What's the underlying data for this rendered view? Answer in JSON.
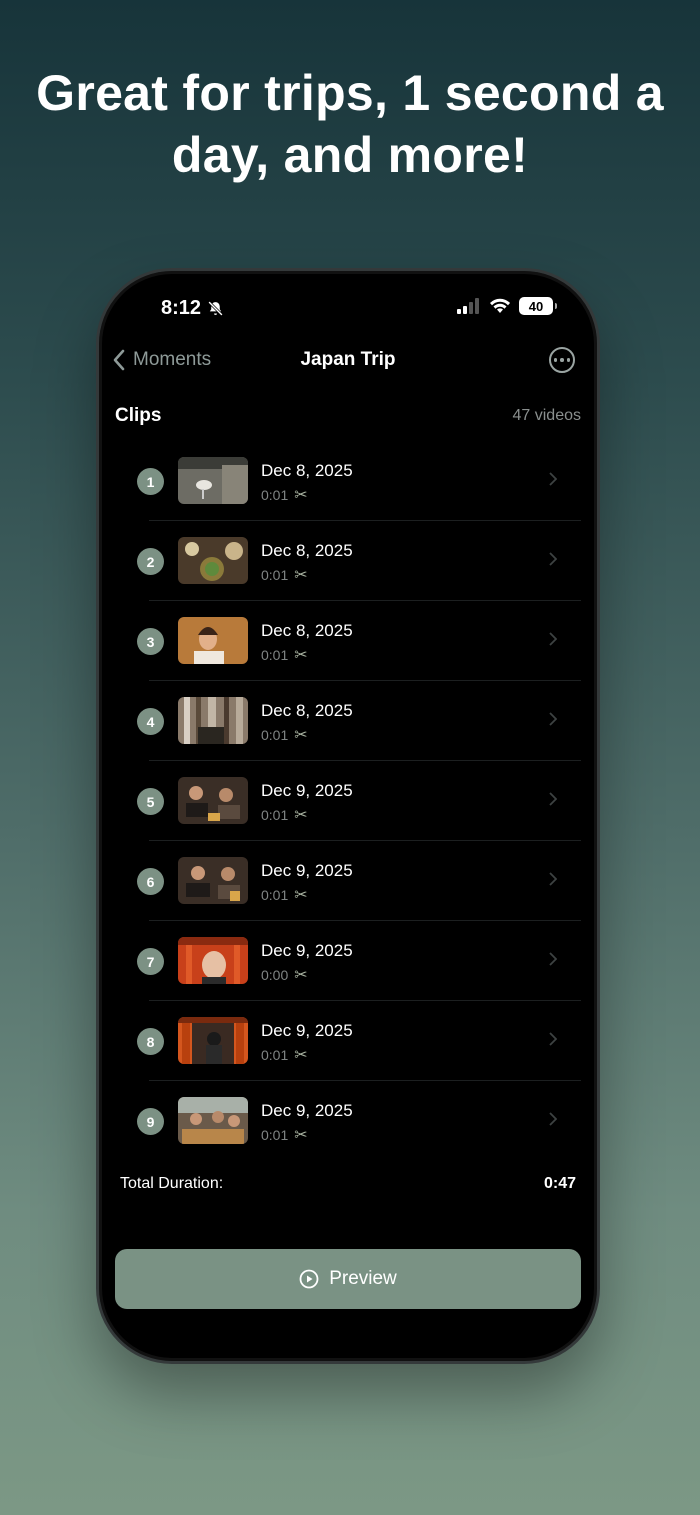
{
  "headline": "Great for trips, 1 second a day, and more!",
  "status_bar": {
    "time": "8:12",
    "battery": "40",
    "icons": [
      "bell-slash-icon",
      "signal-icon",
      "wifi-icon",
      "battery-icon"
    ]
  },
  "nav": {
    "back_label": "Moments",
    "title": "Japan Trip",
    "more_icon": "ellipsis-circle-icon"
  },
  "clips_section": {
    "label": "Clips",
    "count": "47 videos"
  },
  "clips": [
    {
      "number": "1",
      "date": "Dec 8, 2025",
      "duration": "0:01"
    },
    {
      "number": "2",
      "date": "Dec 8, 2025",
      "duration": "0:01"
    },
    {
      "number": "3",
      "date": "Dec 8, 2025",
      "duration": "0:01"
    },
    {
      "number": "4",
      "date": "Dec 8, 2025",
      "duration": "0:01"
    },
    {
      "number": "5",
      "date": "Dec 9, 2025",
      "duration": "0:01"
    },
    {
      "number": "6",
      "date": "Dec 9, 2025",
      "duration": "0:01"
    },
    {
      "number": "7",
      "date": "Dec 9, 2025",
      "duration": "0:00"
    },
    {
      "number": "8",
      "date": "Dec 9, 2025",
      "duration": "0:01"
    },
    {
      "number": "9",
      "date": "Dec 9, 2025",
      "duration": "0:01"
    }
  ],
  "total": {
    "label": "Total Duration:",
    "value": "0:47"
  },
  "preview_button": {
    "label": "Preview",
    "icon": "play-circle-icon"
  },
  "colors": {
    "accent": "#7a9284",
    "badge": "#7c9184",
    "background_top": "#17343a",
    "background_bottom": "#7c9885"
  }
}
